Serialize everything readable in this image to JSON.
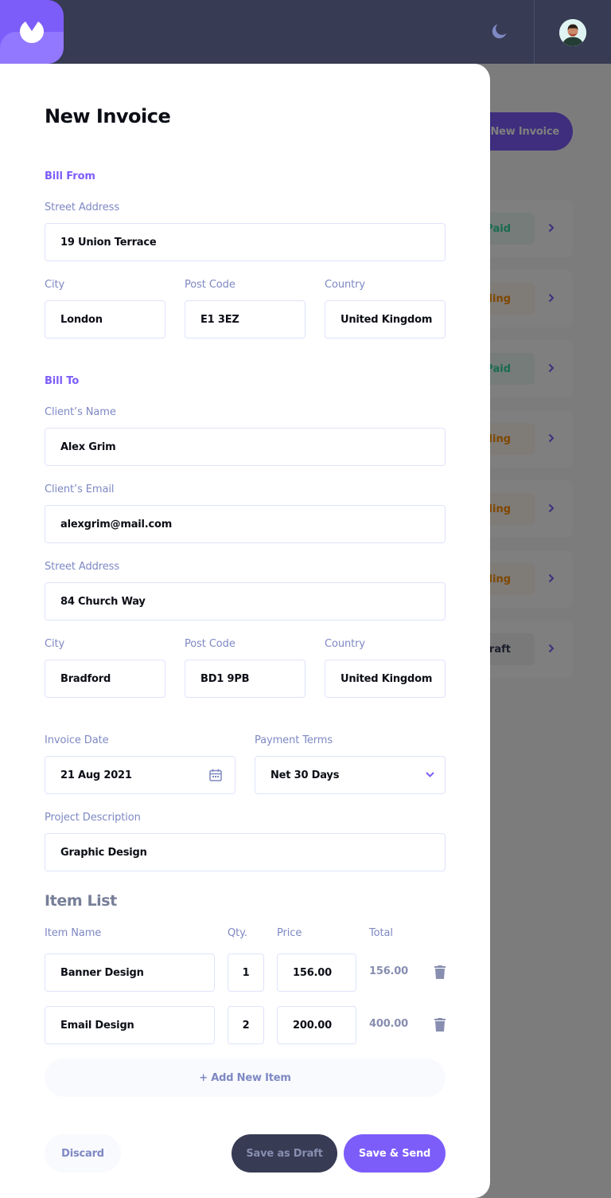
{
  "header": {
    "logo_icon": "logo-icon",
    "theme_icon": "moon-icon",
    "avatar_icon": "avatar-icon"
  },
  "background_list": {
    "new_invoice_label": "New Invoice",
    "invoices": [
      {
        "status": "Paid",
        "status_type": "paid"
      },
      {
        "status": "Pending",
        "status_type": "pending"
      },
      {
        "status": "Paid",
        "status_type": "paid"
      },
      {
        "status": "Pending",
        "status_type": "pending"
      },
      {
        "status": "Pending",
        "status_type": "pending"
      },
      {
        "status": "Pending",
        "status_type": "pending"
      },
      {
        "status": "Draft",
        "status_type": "draft"
      }
    ]
  },
  "form": {
    "title": "New Invoice",
    "bill_from": {
      "section_label": "Bill From",
      "street_label": "Street Address",
      "street": "19 Union Terrace",
      "city_label": "City",
      "city": "London",
      "postcode_label": "Post Code",
      "postcode": "E1 3EZ",
      "country_label": "Country",
      "country": "United Kingdom"
    },
    "bill_to": {
      "section_label": "Bill To",
      "name_label": "Client’s Name",
      "name": "Alex Grim",
      "email_label": "Client’s Email",
      "email": "alexgrim@mail.com",
      "street_label": "Street Address",
      "street": "84 Church Way",
      "city_label": "City",
      "city": "Bradford",
      "postcode_label": "Post Code",
      "postcode": "BD1 9PB",
      "country_label": "Country",
      "country": "United Kingdom"
    },
    "invoice_date_label": "Invoice Date",
    "invoice_date": "21 Aug 2021",
    "payment_terms_label": "Payment Terms",
    "payment_terms": "Net 30 Days",
    "description_label": "Project Description",
    "description": "Graphic Design"
  },
  "item_list": {
    "title": "Item List",
    "headers": {
      "name": "Item Name",
      "qty": "Qty.",
      "price": "Price",
      "total": "Total"
    },
    "items": [
      {
        "name": "Banner Design",
        "qty": "1",
        "price": "156.00",
        "total": "156.00"
      },
      {
        "name": "Email Design",
        "qty": "2",
        "price": "200.00",
        "total": "400.00"
      }
    ],
    "add_label": "+ Add New Item"
  },
  "actions": {
    "discard": "Discard",
    "save_draft": "Save as Draft",
    "save_send": "Save & Send"
  },
  "colors": {
    "accent": "#7c5dfa",
    "header_bg": "#373b53",
    "paid": "#33d69f",
    "pending": "#ff8f00",
    "draft": "#373b53"
  }
}
